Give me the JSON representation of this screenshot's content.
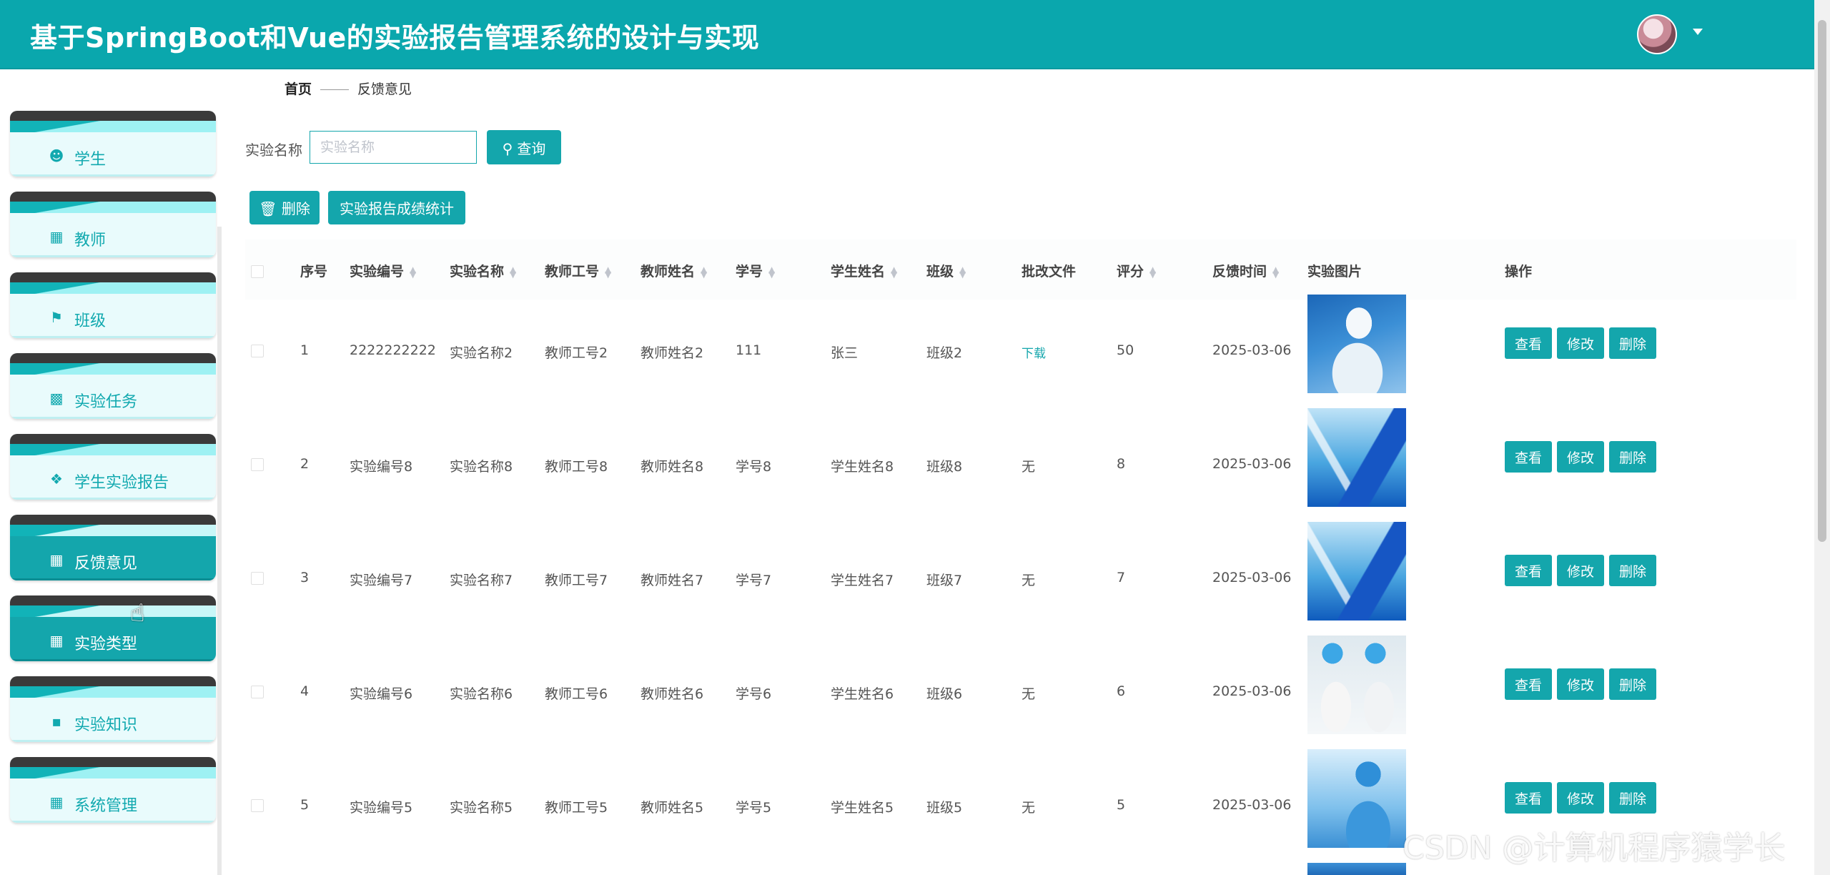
{
  "header": {
    "title": "基于SpringBoot和Vue的实验报告管理系统的设计与实现"
  },
  "sidebar": {
    "items": [
      {
        "label": "学生",
        "icon": "user-icon",
        "active": false
      },
      {
        "label": "教师",
        "icon": "grid-icon",
        "active": false
      },
      {
        "label": "班级",
        "icon": "flag-icon",
        "active": false
      },
      {
        "label": "实验任务",
        "icon": "bar-chart-icon",
        "active": false
      },
      {
        "label": "学生实验报告",
        "icon": "ticket-icon",
        "active": false
      },
      {
        "label": "反馈意见",
        "icon": "grid-icon",
        "active": true
      },
      {
        "label": "实验类型",
        "icon": "apps-icon",
        "active": true
      },
      {
        "label": "实验知识",
        "icon": "brush-icon",
        "active": false
      },
      {
        "label": "系统管理",
        "icon": "grid-icon",
        "active": false
      }
    ]
  },
  "breadcrumb": {
    "home": "首页",
    "current": "反馈意见"
  },
  "search": {
    "label": "实验名称",
    "placeholder": "实验名称",
    "value": "",
    "button_label": "查询"
  },
  "toolbar": {
    "delete_label": "删除",
    "stats_label": "实验报告成绩统计"
  },
  "table": {
    "headers": [
      "序号",
      "实验编号",
      "实验名称",
      "教师工号",
      "教师姓名",
      "学号",
      "学生姓名",
      "班级",
      "批改文件",
      "评分",
      "反馈时间",
      "实验图片",
      "操作"
    ],
    "rows": [
      {
        "seq": "1",
        "exp_no": "2222222222",
        "exp_name": "实验名称2",
        "teacher_no": "教师工号2",
        "teacher_name": "教师姓名2",
        "student_no": "111",
        "student_name": "张三",
        "class": "班级2",
        "file": "下载",
        "score": "50",
        "time": "2025-03-06"
      },
      {
        "seq": "2",
        "exp_no": "实验编号8",
        "exp_name": "实验名称8",
        "teacher_no": "教师工号8",
        "teacher_name": "教师姓名8",
        "student_no": "学号8",
        "student_name": "学生姓名8",
        "class": "班级8",
        "file": "无",
        "score": "8",
        "time": "2025-03-06"
      },
      {
        "seq": "3",
        "exp_no": "实验编号7",
        "exp_name": "实验名称7",
        "teacher_no": "教师工号7",
        "teacher_name": "教师姓名7",
        "student_no": "学号7",
        "student_name": "学生姓名7",
        "class": "班级7",
        "file": "无",
        "score": "7",
        "time": "2025-03-06"
      },
      {
        "seq": "4",
        "exp_no": "实验编号6",
        "exp_name": "实验名称6",
        "teacher_no": "教师工号6",
        "teacher_name": "教师姓名6",
        "student_no": "学号6",
        "student_name": "学生姓名6",
        "class": "班级6",
        "file": "无",
        "score": "6",
        "time": "2025-03-06"
      },
      {
        "seq": "5",
        "exp_no": "实验编号5",
        "exp_name": "实验名称5",
        "teacher_no": "教师工号5",
        "teacher_name": "教师姓名5",
        "student_no": "学号5",
        "student_name": "学生姓名5",
        "class": "班级5",
        "file": "无",
        "score": "5",
        "time": "2025-03-06"
      }
    ],
    "actions": {
      "view": "查看",
      "edit": "修改",
      "delete": "删除"
    }
  },
  "watermark": "CSDN @计算机程序猿学长",
  "colors": {
    "accent": "#14a6ac",
    "header": "#0aa7ad"
  }
}
